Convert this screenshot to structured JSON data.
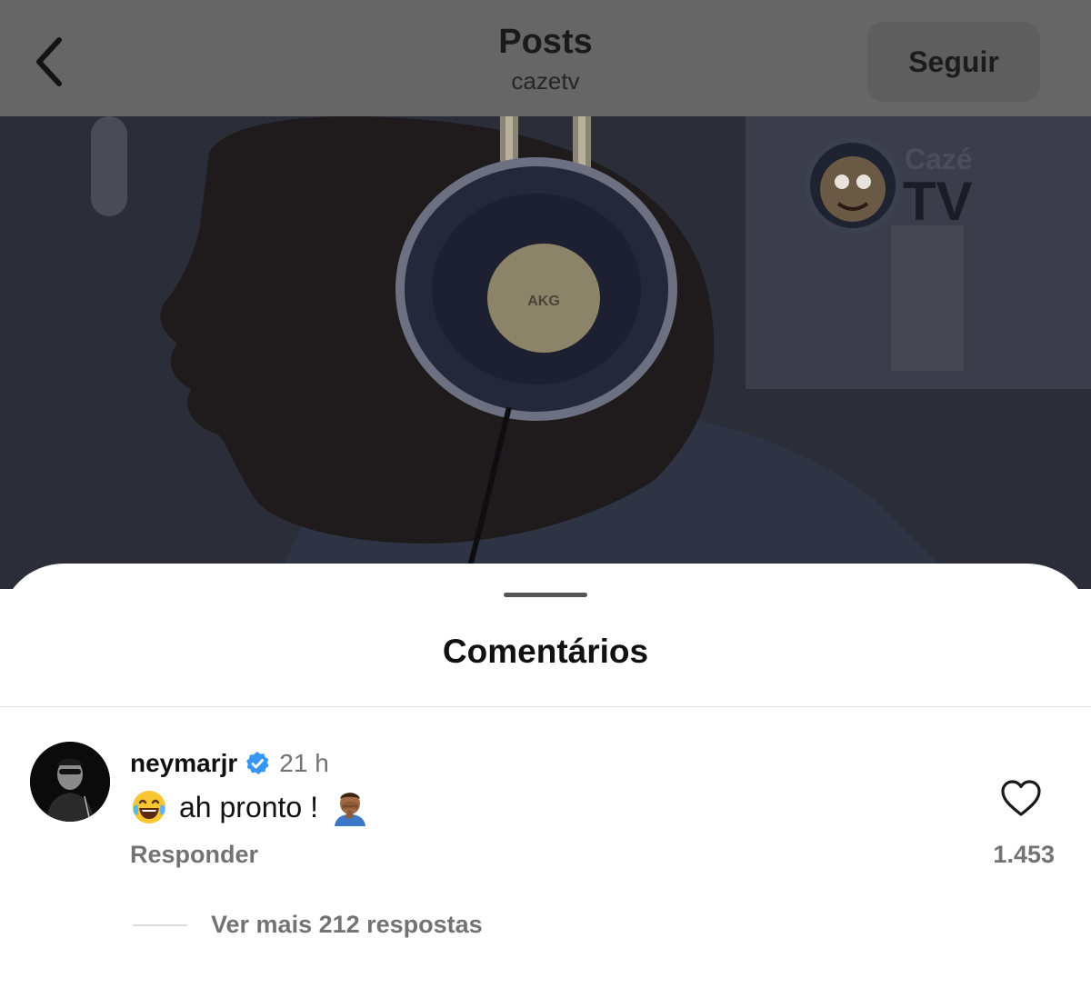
{
  "header": {
    "title": "Posts",
    "subtitle": "cazetv",
    "follow_label": "Seguir",
    "back_icon": "chevron-left-icon"
  },
  "post": {
    "watermark_line1": "Cazé",
    "watermark_line2": "TV",
    "headphone_brand": "AKG"
  },
  "comments_sheet": {
    "title": "Comentários",
    "comment": {
      "username": "neymarjr",
      "verified": true,
      "time": "21 h",
      "text": "ah pronto !",
      "emojis": [
        "face-with-tears-of-joy",
        "man-facepalming"
      ],
      "reply_label": "Responder",
      "likes": "1.453"
    },
    "more_replies_label": "Ver mais 212 respostas"
  },
  "colors": {
    "verified_blue": "#3797f0",
    "secondary_text": "#737373"
  }
}
